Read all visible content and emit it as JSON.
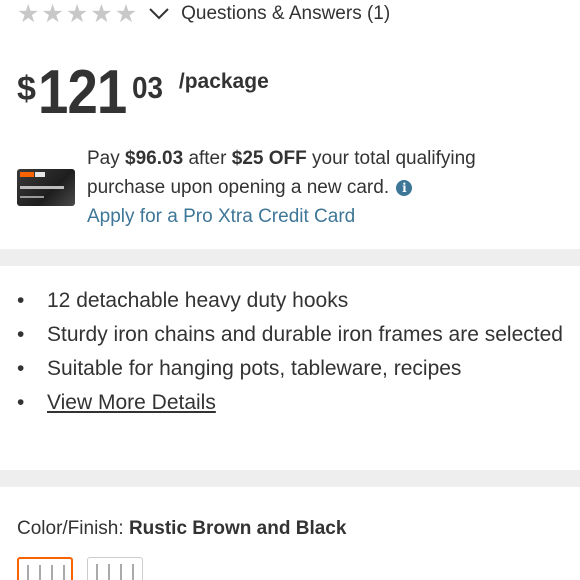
{
  "rating": {
    "stars_filled": 0,
    "stars_total": 5,
    "qa_label": "Questions & Answers (1)"
  },
  "price": {
    "currency": "$",
    "dollars": "121",
    "cents": "03",
    "unit": "/package"
  },
  "promo": {
    "pay_prefix": "Pay",
    "pay_amount": "$96.03",
    "after_text": "after",
    "discount": "$25 OFF",
    "line1_rest": "your total qualifying",
    "line2": "purchase upon opening a new card.",
    "apply_link": "Apply for a Pro Xtra Credit Card"
  },
  "highlights": {
    "items": [
      "12 detachable heavy duty hooks",
      "Sturdy iron chains and durable iron frames are selected",
      "Suitable for hanging pots, tableware, recipes"
    ],
    "view_more": "View More Details"
  },
  "color_finish": {
    "label": "Color/Finish:",
    "value": "Rustic Brown and Black"
  },
  "colors": {
    "accent": "#f96302",
    "link": "#3e7697",
    "text": "#333333",
    "star_empty": "#c8c8c8",
    "divider": "#eeeeee"
  }
}
